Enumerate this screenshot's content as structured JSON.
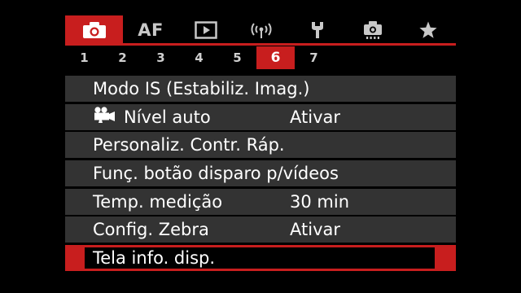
{
  "tabs": [
    {
      "name": "shooting",
      "icon": "camera-icon",
      "active": true
    },
    {
      "name": "af",
      "label": "AF"
    },
    {
      "name": "playback",
      "icon": "play-icon"
    },
    {
      "name": "wireless",
      "icon": "wireless-icon"
    },
    {
      "name": "setup",
      "icon": "wrench-icon"
    },
    {
      "name": "custom-functions",
      "icon": "custom-camera-icon"
    },
    {
      "name": "my-menu",
      "icon": "star-icon"
    }
  ],
  "pages": [
    "1",
    "2",
    "3",
    "4",
    "5",
    "6",
    "7"
  ],
  "active_page": "6",
  "menu": {
    "items": [
      {
        "label": "Modo IS (Estabiliz. Imag.)",
        "value": ""
      },
      {
        "label": "Nível auto",
        "value": "Ativar",
        "icon": "movie-camera-icon"
      },
      {
        "label": "Personaliz. Contr. Ráp.",
        "value": ""
      },
      {
        "label": "Funç. botão disparo p/vídeos",
        "value": ""
      },
      {
        "label": "Temp. medição",
        "value": "30 min"
      },
      {
        "label": "Config. Zebra",
        "value": "Ativar"
      },
      {
        "label": "Tela info. disp.",
        "value": "",
        "selected": true
      }
    ]
  },
  "colors": {
    "accent": "#c81e1e",
    "row_background": "#333333",
    "background": "#000000",
    "text": "#ffffff"
  }
}
